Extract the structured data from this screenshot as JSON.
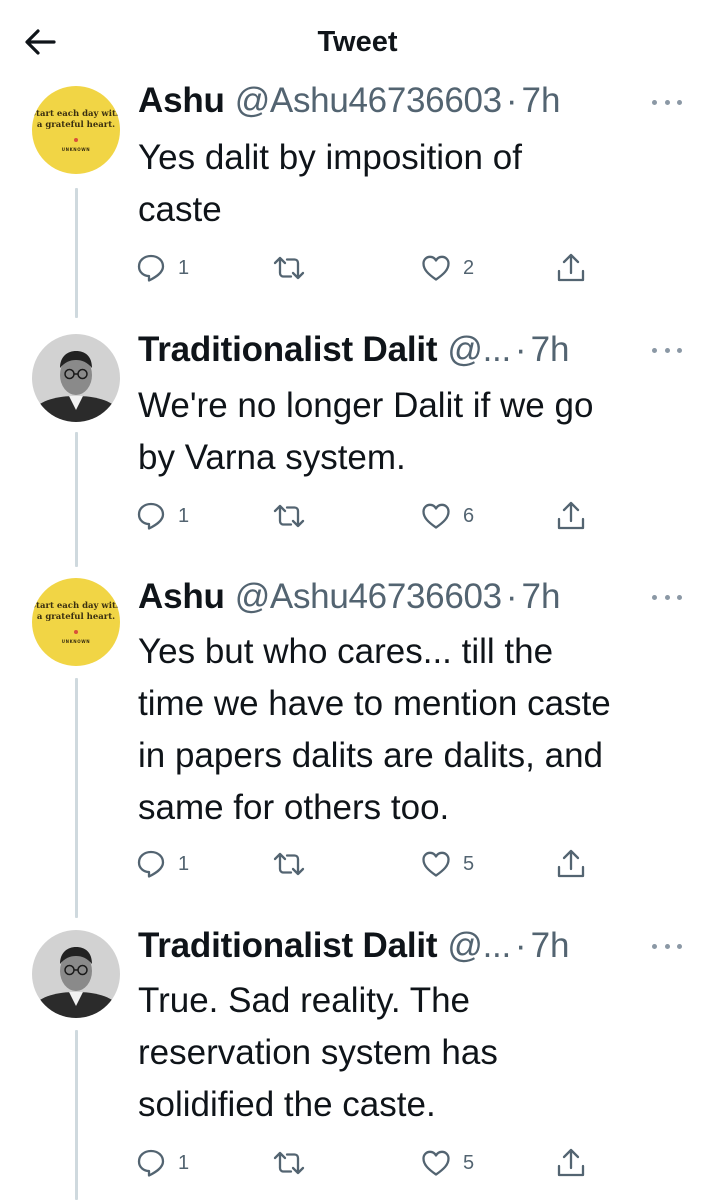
{
  "header": {
    "title": "Tweet",
    "back_icon": "arrow-left-icon"
  },
  "avatar_quote": {
    "line1": "Start each day with",
    "line2": "a grateful heart.",
    "author": "UNKNOWN"
  },
  "tweets": [
    {
      "name": "Ashu",
      "handle": "@Ashu46736603",
      "separator": "·",
      "time": "7h",
      "text": "Yes dalit by imposition of\ncaste",
      "replies": "1",
      "retweets": "",
      "likes": "2",
      "avatar": "quote"
    },
    {
      "name": "Traditionalist Dalit",
      "handle": "@...",
      "separator": "·",
      "time": "7h",
      "text": "We're no longer Dalit if we go\nby Varna system.",
      "replies": "1",
      "retweets": "",
      "likes": "6",
      "avatar": "portrait"
    },
    {
      "name": "Ashu",
      "handle": "@Ashu46736603",
      "separator": "·",
      "time": "7h",
      "text": "Yes but who cares... till the\ntime we have to mention caste\nin papers dalits are dalits, and\nsame for others too.",
      "replies": "1",
      "retweets": "",
      "likes": "5",
      "avatar": "quote"
    },
    {
      "name": "Traditionalist Dalit",
      "handle": "@...",
      "separator": "·",
      "time": "7h",
      "text": "True. Sad reality. The\nreservation system has\nsolidified the caste.",
      "replies": "1",
      "retweets": "",
      "likes": "5",
      "avatar": "portrait"
    }
  ],
  "colors": {
    "text": "#0f1419",
    "secondary": "#536471",
    "thread_line": "#cfd9de",
    "avatar_yellow": "#f1d545"
  }
}
